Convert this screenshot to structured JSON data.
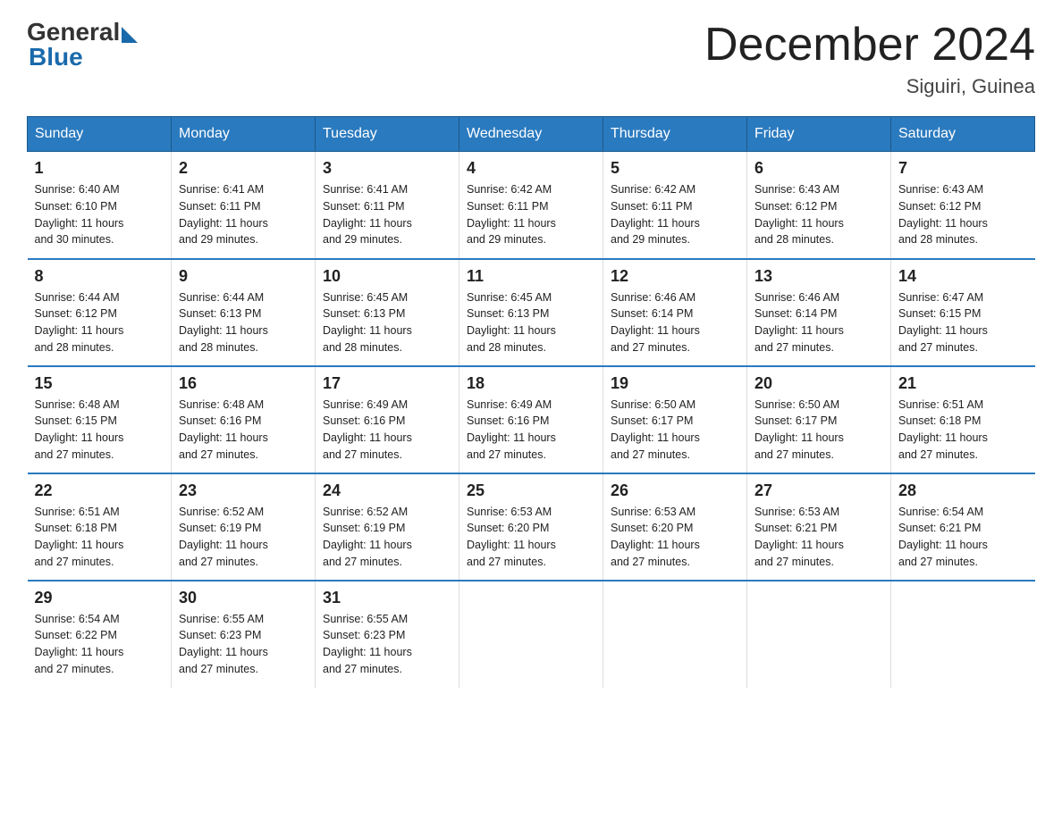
{
  "header": {
    "logo_general": "General",
    "logo_blue": "Blue",
    "month_title": "December 2024",
    "location": "Siguiri, Guinea"
  },
  "days_of_week": [
    "Sunday",
    "Monday",
    "Tuesday",
    "Wednesday",
    "Thursday",
    "Friday",
    "Saturday"
  ],
  "weeks": [
    [
      {
        "num": "1",
        "sunrise": "6:40 AM",
        "sunset": "6:10 PM",
        "daylight": "11 hours and 30 minutes."
      },
      {
        "num": "2",
        "sunrise": "6:41 AM",
        "sunset": "6:11 PM",
        "daylight": "11 hours and 29 minutes."
      },
      {
        "num": "3",
        "sunrise": "6:41 AM",
        "sunset": "6:11 PM",
        "daylight": "11 hours and 29 minutes."
      },
      {
        "num": "4",
        "sunrise": "6:42 AM",
        "sunset": "6:11 PM",
        "daylight": "11 hours and 29 minutes."
      },
      {
        "num": "5",
        "sunrise": "6:42 AM",
        "sunset": "6:11 PM",
        "daylight": "11 hours and 29 minutes."
      },
      {
        "num": "6",
        "sunrise": "6:43 AM",
        "sunset": "6:12 PM",
        "daylight": "11 hours and 28 minutes."
      },
      {
        "num": "7",
        "sunrise": "6:43 AM",
        "sunset": "6:12 PM",
        "daylight": "11 hours and 28 minutes."
      }
    ],
    [
      {
        "num": "8",
        "sunrise": "6:44 AM",
        "sunset": "6:12 PM",
        "daylight": "11 hours and 28 minutes."
      },
      {
        "num": "9",
        "sunrise": "6:44 AM",
        "sunset": "6:13 PM",
        "daylight": "11 hours and 28 minutes."
      },
      {
        "num": "10",
        "sunrise": "6:45 AM",
        "sunset": "6:13 PM",
        "daylight": "11 hours and 28 minutes."
      },
      {
        "num": "11",
        "sunrise": "6:45 AM",
        "sunset": "6:13 PM",
        "daylight": "11 hours and 28 minutes."
      },
      {
        "num": "12",
        "sunrise": "6:46 AM",
        "sunset": "6:14 PM",
        "daylight": "11 hours and 27 minutes."
      },
      {
        "num": "13",
        "sunrise": "6:46 AM",
        "sunset": "6:14 PM",
        "daylight": "11 hours and 27 minutes."
      },
      {
        "num": "14",
        "sunrise": "6:47 AM",
        "sunset": "6:15 PM",
        "daylight": "11 hours and 27 minutes."
      }
    ],
    [
      {
        "num": "15",
        "sunrise": "6:48 AM",
        "sunset": "6:15 PM",
        "daylight": "11 hours and 27 minutes."
      },
      {
        "num": "16",
        "sunrise": "6:48 AM",
        "sunset": "6:16 PM",
        "daylight": "11 hours and 27 minutes."
      },
      {
        "num": "17",
        "sunrise": "6:49 AM",
        "sunset": "6:16 PM",
        "daylight": "11 hours and 27 minutes."
      },
      {
        "num": "18",
        "sunrise": "6:49 AM",
        "sunset": "6:16 PM",
        "daylight": "11 hours and 27 minutes."
      },
      {
        "num": "19",
        "sunrise": "6:50 AM",
        "sunset": "6:17 PM",
        "daylight": "11 hours and 27 minutes."
      },
      {
        "num": "20",
        "sunrise": "6:50 AM",
        "sunset": "6:17 PM",
        "daylight": "11 hours and 27 minutes."
      },
      {
        "num": "21",
        "sunrise": "6:51 AM",
        "sunset": "6:18 PM",
        "daylight": "11 hours and 27 minutes."
      }
    ],
    [
      {
        "num": "22",
        "sunrise": "6:51 AM",
        "sunset": "6:18 PM",
        "daylight": "11 hours and 27 minutes."
      },
      {
        "num": "23",
        "sunrise": "6:52 AM",
        "sunset": "6:19 PM",
        "daylight": "11 hours and 27 minutes."
      },
      {
        "num": "24",
        "sunrise": "6:52 AM",
        "sunset": "6:19 PM",
        "daylight": "11 hours and 27 minutes."
      },
      {
        "num": "25",
        "sunrise": "6:53 AM",
        "sunset": "6:20 PM",
        "daylight": "11 hours and 27 minutes."
      },
      {
        "num": "26",
        "sunrise": "6:53 AM",
        "sunset": "6:20 PM",
        "daylight": "11 hours and 27 minutes."
      },
      {
        "num": "27",
        "sunrise": "6:53 AM",
        "sunset": "6:21 PM",
        "daylight": "11 hours and 27 minutes."
      },
      {
        "num": "28",
        "sunrise": "6:54 AM",
        "sunset": "6:21 PM",
        "daylight": "11 hours and 27 minutes."
      }
    ],
    [
      {
        "num": "29",
        "sunrise": "6:54 AM",
        "sunset": "6:22 PM",
        "daylight": "11 hours and 27 minutes."
      },
      {
        "num": "30",
        "sunrise": "6:55 AM",
        "sunset": "6:23 PM",
        "daylight": "11 hours and 27 minutes."
      },
      {
        "num": "31",
        "sunrise": "6:55 AM",
        "sunset": "6:23 PM",
        "daylight": "11 hours and 27 minutes."
      },
      null,
      null,
      null,
      null
    ]
  ],
  "labels": {
    "sunrise": "Sunrise:",
    "sunset": "Sunset:",
    "daylight": "Daylight:"
  }
}
